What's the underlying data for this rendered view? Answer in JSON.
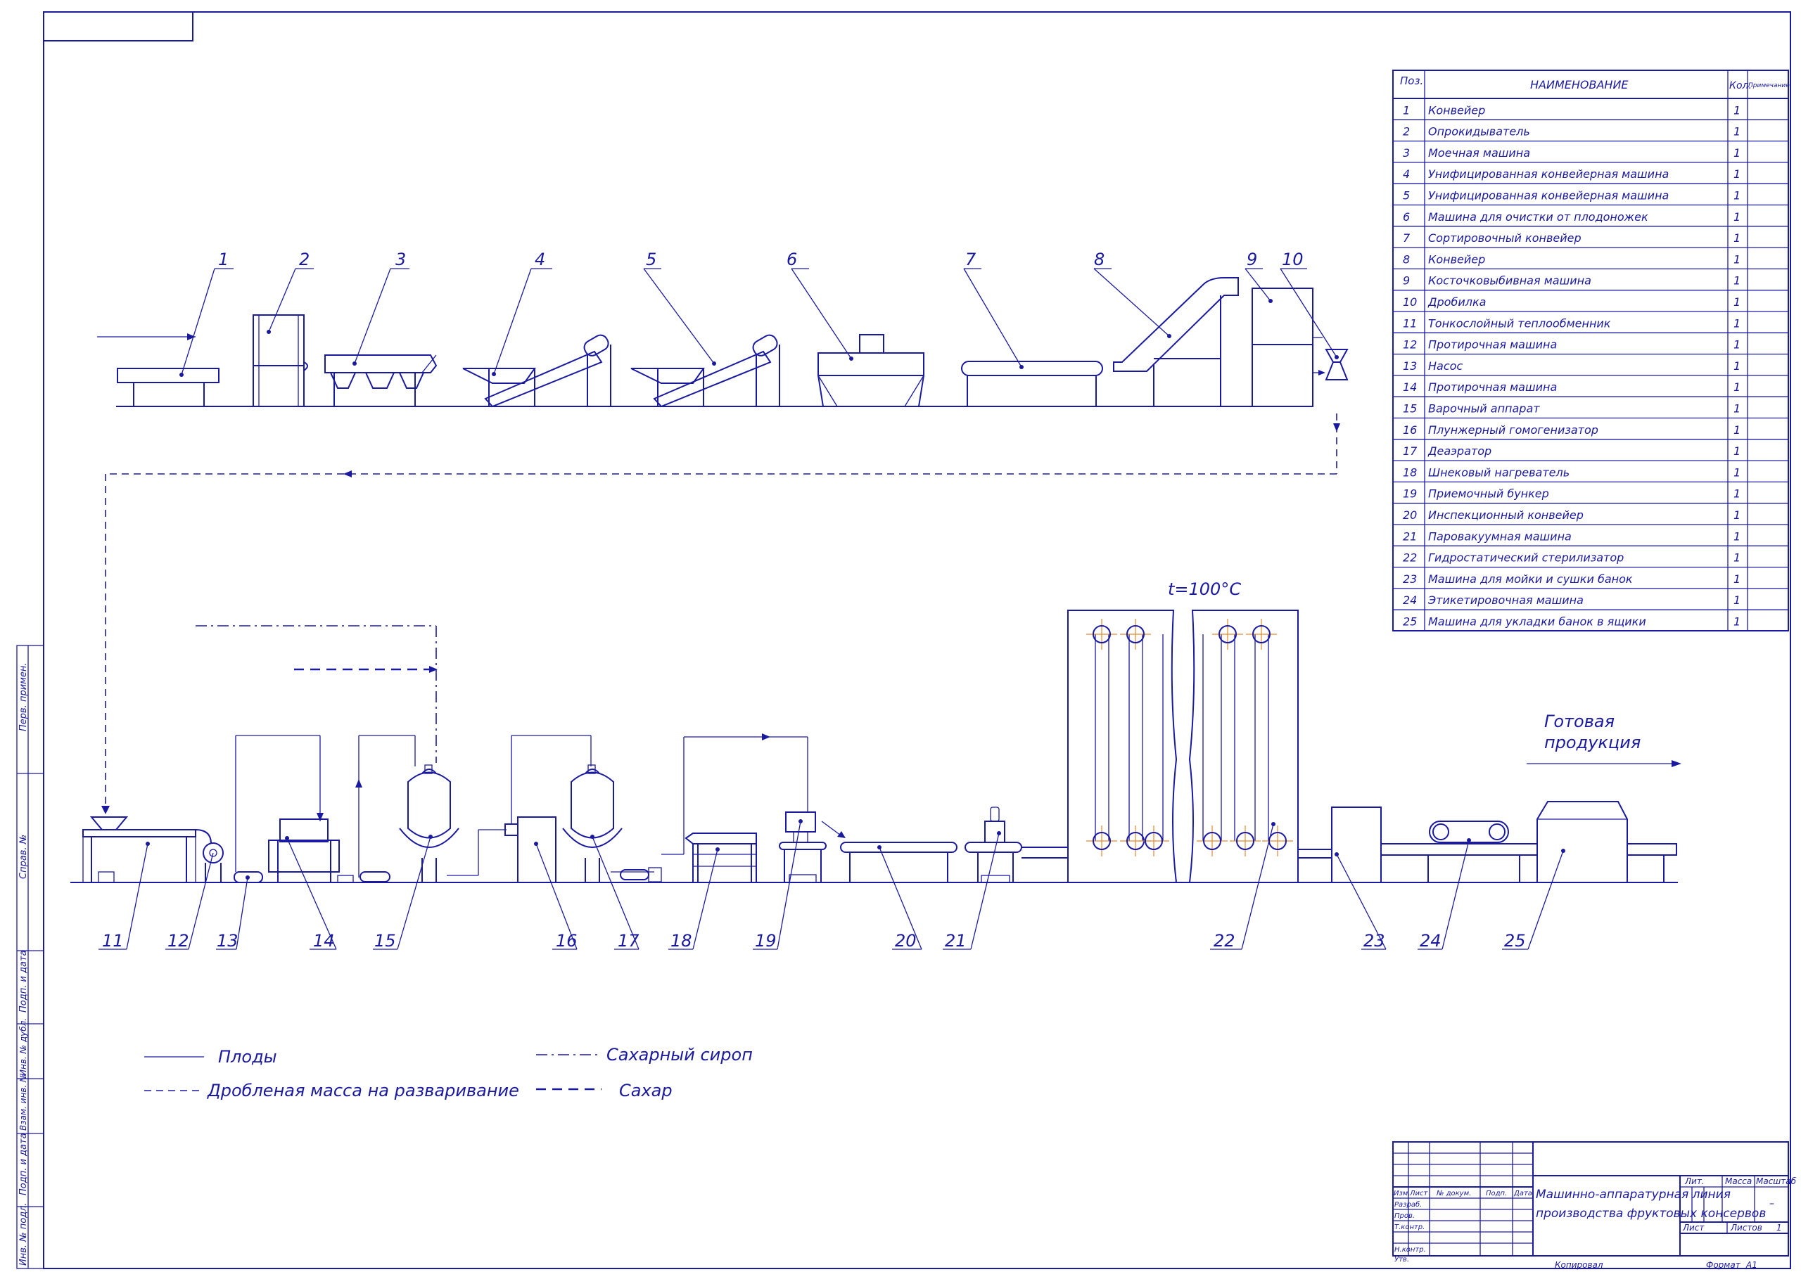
{
  "colors": {
    "ink": "#1a1aa0",
    "paper": "#ffffff",
    "accent": "#e08a30"
  },
  "spec_table": {
    "header": {
      "pos": "Поз.",
      "name": "НАИМЕНОВАНИЕ",
      "qty": "Кол.",
      "note": "Примечание"
    },
    "rows": [
      {
        "pos": "1",
        "name": "Конвейер",
        "qty": "1"
      },
      {
        "pos": "2",
        "name": "Опрокидыватель",
        "qty": "1"
      },
      {
        "pos": "3",
        "name": "Моечная машина",
        "qty": "1"
      },
      {
        "pos": "4",
        "name": "Унифицированная конвейерная машина",
        "qty": "1"
      },
      {
        "pos": "5",
        "name": "Унифицированная конвейерная машина",
        "qty": "1"
      },
      {
        "pos": "6",
        "name": "Машина для очистки от плодоножек",
        "qty": "1"
      },
      {
        "pos": "7",
        "name": "Сортировочный конвейер",
        "qty": "1"
      },
      {
        "pos": "8",
        "name": "Конвейер",
        "qty": "1"
      },
      {
        "pos": "9",
        "name": "Косточковыбивная машина",
        "qty": "1"
      },
      {
        "pos": "10",
        "name": "Дробилка",
        "qty": "1"
      },
      {
        "pos": "11",
        "name": "Тонкослойный теплообменник",
        "qty": "1"
      },
      {
        "pos": "12",
        "name": "Протирочная машина",
        "qty": "1"
      },
      {
        "pos": "13",
        "name": "Насос",
        "qty": "1"
      },
      {
        "pos": "14",
        "name": "Протирочная машина",
        "qty": "1"
      },
      {
        "pos": "15",
        "name": "Варочный аппарат",
        "qty": "1"
      },
      {
        "pos": "16",
        "name": "Плунжерный гомогенизатор",
        "qty": "1"
      },
      {
        "pos": "17",
        "name": "Деаэратор",
        "qty": "1"
      },
      {
        "pos": "18",
        "name": "Шнековый нагреватель",
        "qty": "1"
      },
      {
        "pos": "19",
        "name": "Приемочный бункер",
        "qty": "1"
      },
      {
        "pos": "20",
        "name": "Инспекционный конвейер",
        "qty": "1"
      },
      {
        "pos": "21",
        "name": "Паровакуумная машина",
        "qty": "1"
      },
      {
        "pos": "22",
        "name": "Гидростатический стерилизатор",
        "qty": "1"
      },
      {
        "pos": "23",
        "name": "Машина для мойки и сушки банок",
        "qty": "1"
      },
      {
        "pos": "24",
        "name": "Этикетировочная машина",
        "qty": "1"
      },
      {
        "pos": "25",
        "name": "Машина для укладки банок в ящики",
        "qty": "1"
      }
    ]
  },
  "callouts_top": [
    "1",
    "2",
    "3",
    "4",
    "5",
    "6",
    "7",
    "8",
    "9",
    "10"
  ],
  "callouts_bottom": [
    "11",
    "12",
    "13",
    "14",
    "15",
    "16",
    "17",
    "18",
    "19",
    "20",
    "21",
    "22",
    "23",
    "24",
    "25"
  ],
  "annotations": {
    "temperature": "t=100°C",
    "output_line1": "Готовая",
    "output_line2": "продукция"
  },
  "legend": [
    {
      "style": "solid",
      "label": "Плоды"
    },
    {
      "style": "dashed",
      "label": "Дробленая масса на разваривание"
    },
    {
      "style": "dashdot",
      "label": "Сахарный сироп"
    },
    {
      "style": "bold-dashed",
      "label": "Сахар"
    }
  ],
  "side_stamp": [
    "Перв. примен.",
    "Справ. №",
    "Подп. и дата",
    "Инв. № дубл.",
    "Взам. инв. №",
    "Подп. и дата",
    "Инв. № подл."
  ],
  "title_block": {
    "title_line1": "Машинно-аппаратурная линия",
    "title_line2": "производства фруктовых консервов",
    "col_headers": [
      "Изм.",
      "Лист",
      "№ докум.",
      "Подп.",
      "Дата"
    ],
    "roles": [
      "Разраб.",
      "Пров.",
      "Т.контр.",
      "",
      "Н.контр.",
      "Утв."
    ],
    "lit": "Лит.",
    "mass": "Масса",
    "scale": "Масштаб",
    "scale_value": "–",
    "sheet": "Лист",
    "sheets": "Листов",
    "sheets_value": "1",
    "copied": "Копировал",
    "format": "Формат",
    "format_value": "А1"
  }
}
